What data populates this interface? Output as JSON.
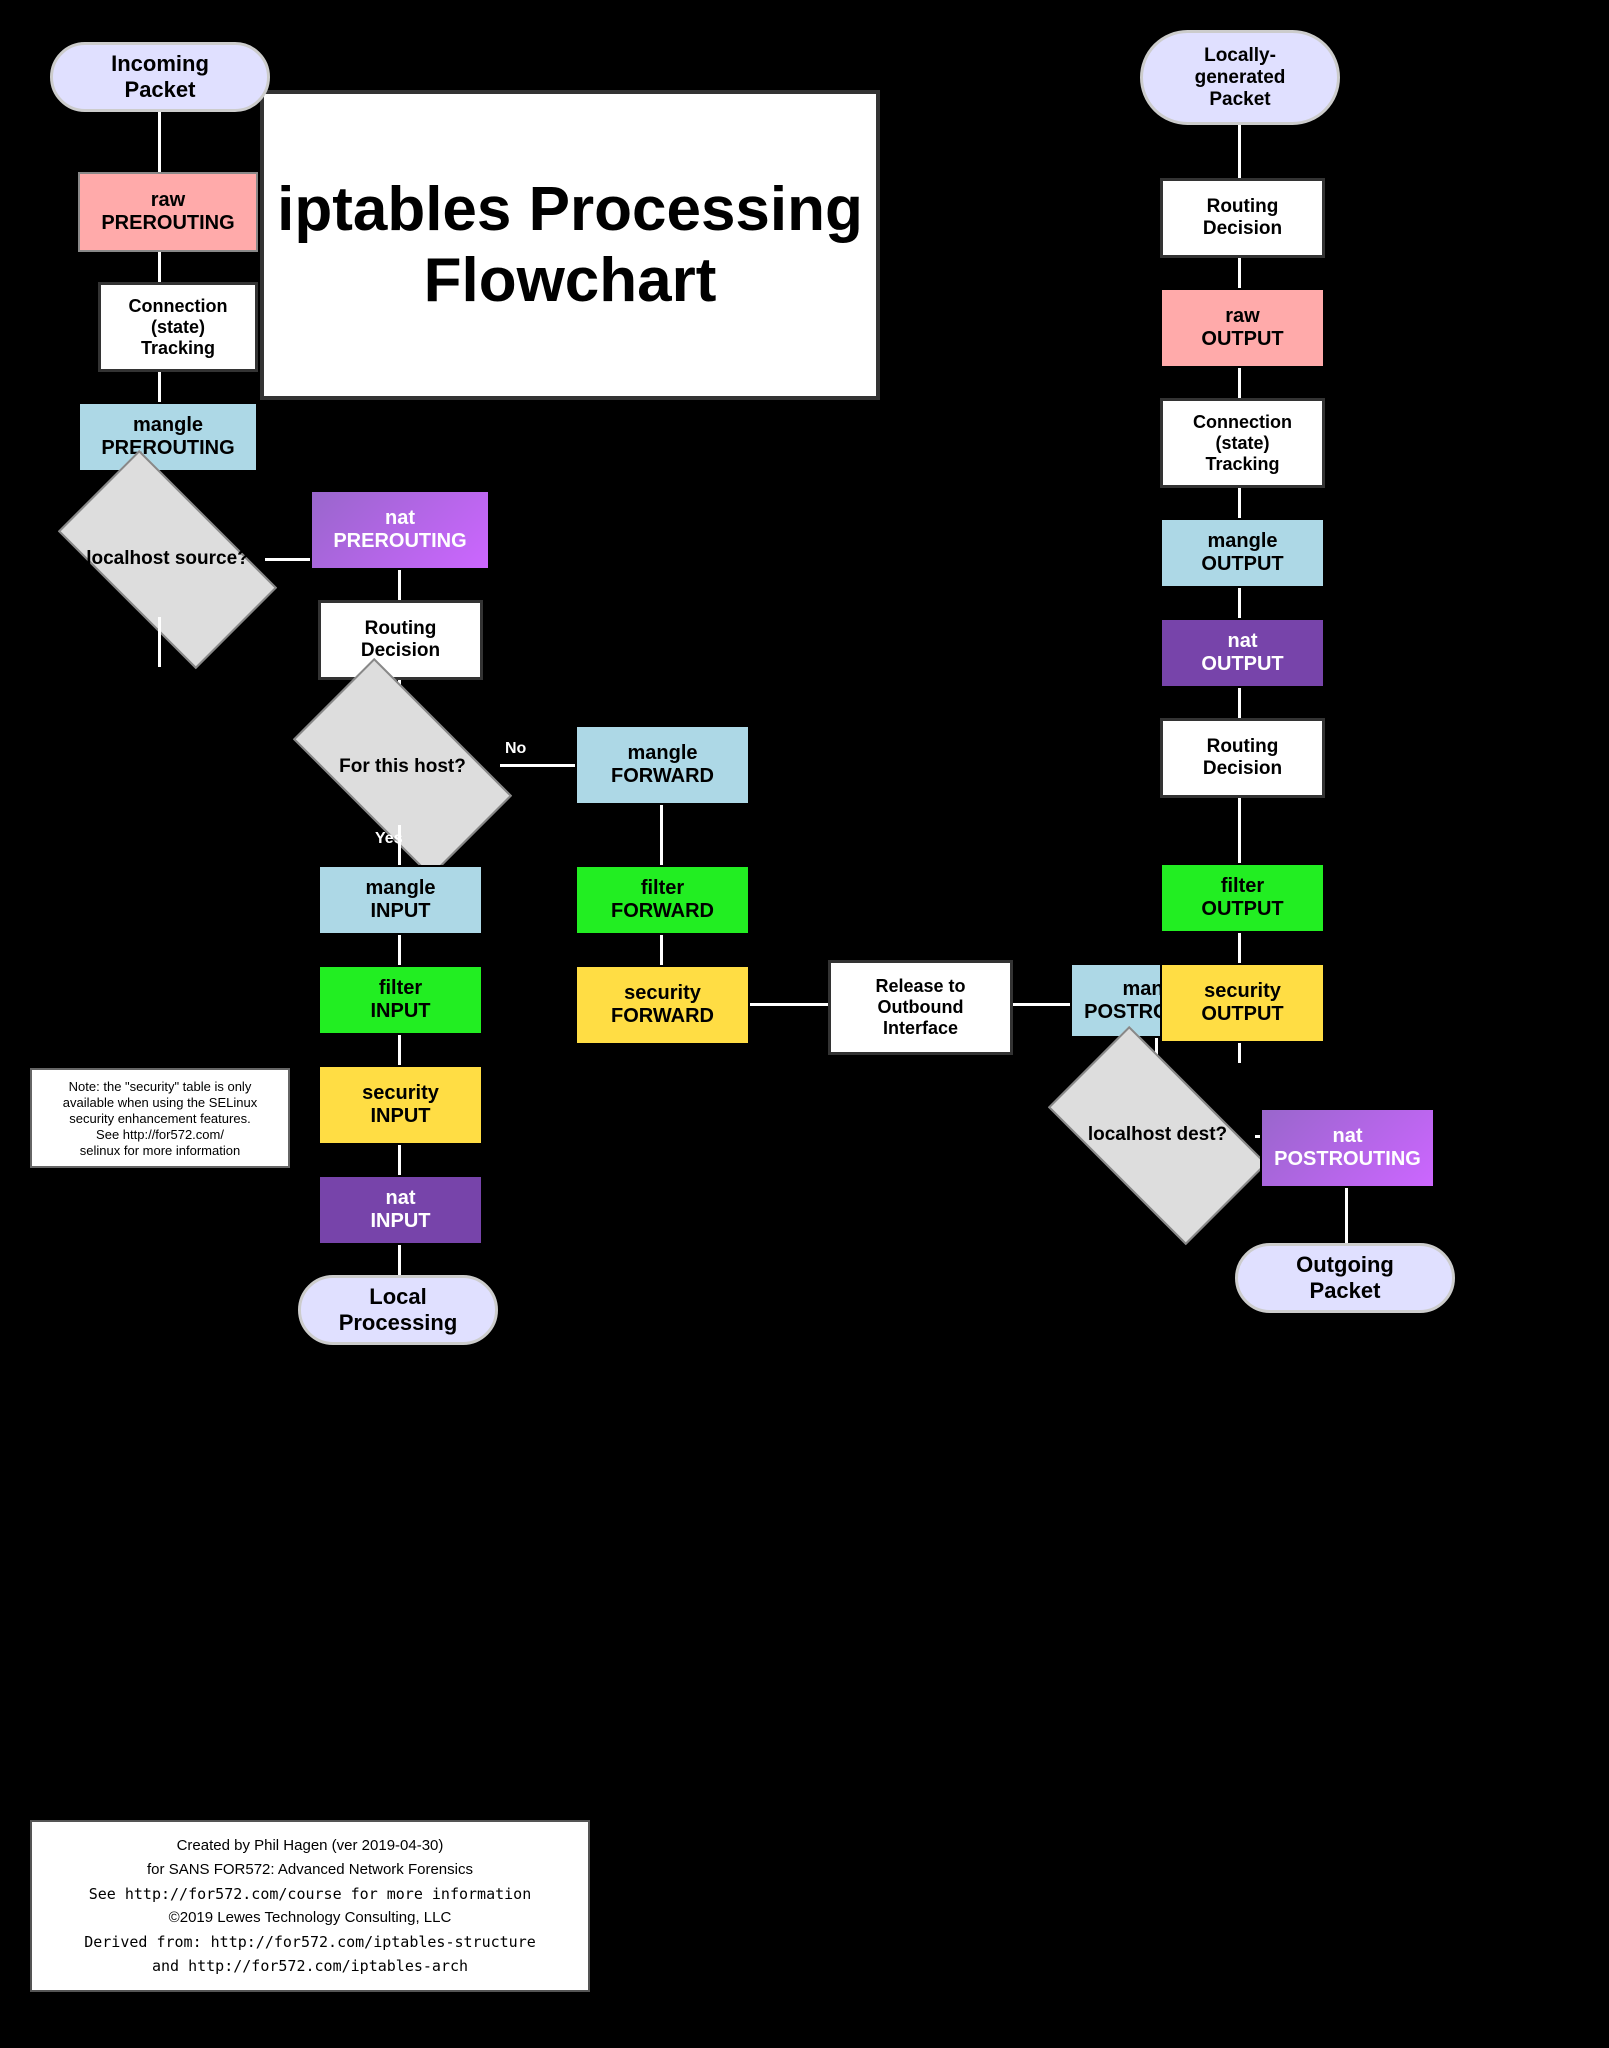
{
  "title": "iptables Processing Flowchart",
  "incoming_packet": "Incoming Packet",
  "locally_generated": "Locally-generated\nPacket",
  "outgoing_packet": "Outgoing Packet",
  "local_processing": "Local\nProcessing",
  "boxes": {
    "raw_prerouting": "raw\nPREROUTING",
    "connection_tracking_left": "Connection\n(state)\nTracking",
    "mangle_prerouting": "mangle\nPREROUTING",
    "localhost_source": "localhost\nsource?",
    "nat_prerouting": "nat\nPREROUTING",
    "routing_decision_1": "Routing\nDecision",
    "for_this_host": "For this\nhost?",
    "mangle_input": "mangle\nINPUT",
    "filter_input": "filter\nINPUT",
    "security_input": "security\nINPUT",
    "nat_input": "nat\nINPUT",
    "mangle_forward": "mangle\nFORWARD",
    "filter_forward": "filter\nFORWARD",
    "security_forward": "security\nFORWARD",
    "release_outbound": "Release to\nOutbound\nInterface",
    "mangle_postrouting_right": "mangle\nPOSTROUTING",
    "localhost_dest": "localhost\ndest?",
    "nat_postrouting": "nat\nPOSTROUTING",
    "routing_decision_top_right": "Routing\nDecision",
    "raw_output": "raw\nOUTPUT",
    "connection_tracking_right": "Connection\n(state)\nTracking",
    "mangle_output": "mangle\nOUTPUT",
    "nat_output": "nat\nOUTPUT",
    "routing_decision_right2": "Routing\nDecision",
    "filter_output": "filter\nOUTPUT",
    "security_output": "security\nOUTPUT"
  },
  "note": "Note: the \"security\" table is only\navailable when using the SELinux\nsecurity enhancement features.\nSee http://for572.com/\nselinux for more information",
  "footer": {
    "line1": "Created by Phil Hagen (ver 2019-04-30)",
    "line2": "for SANS FOR572: Advanced Network Forensics",
    "line3": "See http://for572.com/course for more information",
    "line4": "©2019 Lewes Technology Consulting, LLC",
    "line5": "Derived from: http://for572.com/iptables-structure",
    "line6": "and http://for572.com/iptables-arch"
  }
}
